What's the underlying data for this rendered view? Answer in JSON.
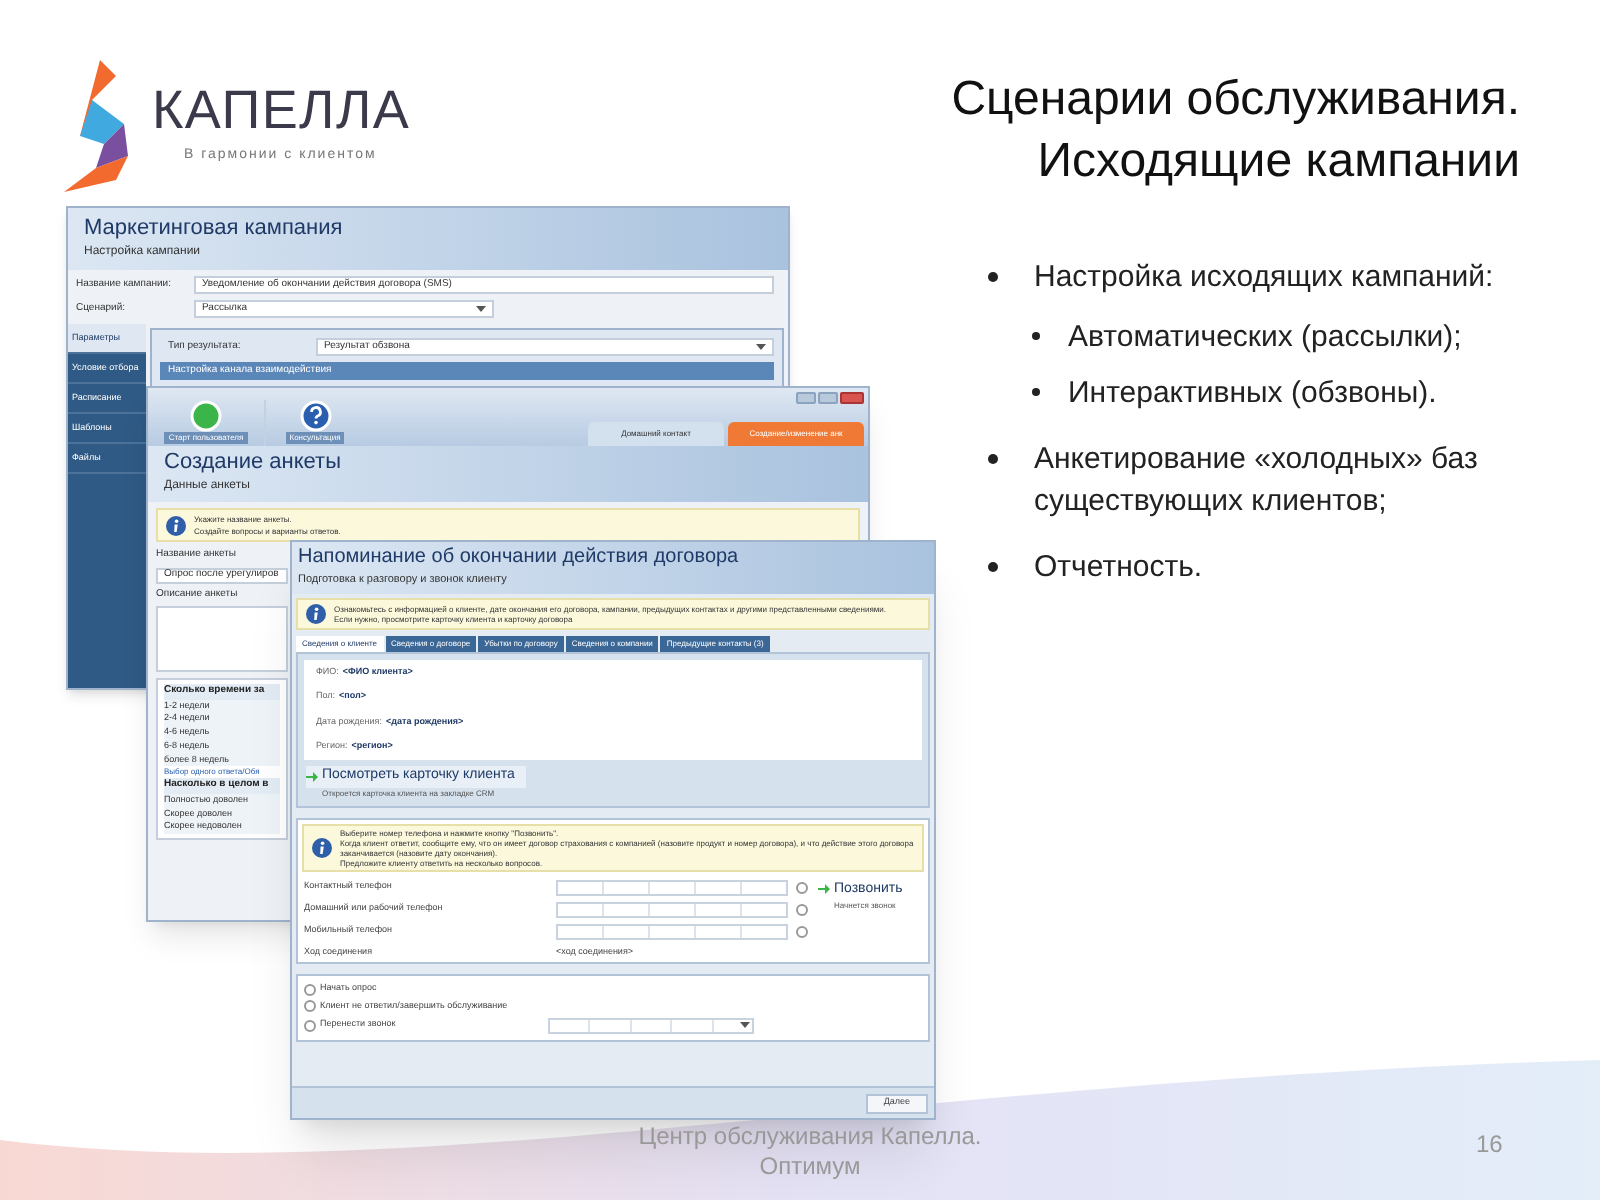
{
  "logo": {
    "name": "КАПЕЛЛА",
    "tagline": "В гармонии с клиентом"
  },
  "title": [
    "Сценарии обслуживания.",
    "Исходящие кампании"
  ],
  "campaign_window": {
    "title": "Маркетинговая кампания",
    "subtitle": "Настройка кампании",
    "fields": [
      {
        "kind": "text",
        "label": "Название кампании:",
        "value": "Уведомление об окончании действия договора (SMS)"
      },
      {
        "kind": "select",
        "label": "Сценарий:",
        "value": "Рассылка"
      }
    ],
    "nav": [
      {
        "label": "Параметры",
        "selected": true
      },
      {
        "label": "Условие отбора",
        "selected": false
      },
      {
        "label": "Расписание",
        "selected": false
      },
      {
        "label": "Шаблоны",
        "selected": false
      },
      {
        "label": "Файлы",
        "selected": false
      }
    ],
    "result_type": {
      "label": "Тип результата:",
      "value": "Результат обзвона"
    },
    "section": "Настройка канала взаимодействия"
  },
  "survey_window": {
    "toolbar": [
      "Старт пользователя",
      "Консультация"
    ],
    "tabs": [
      {
        "label": "Домашний контакт",
        "selected": false
      },
      {
        "label": "Создание/изменение анк",
        "selected": true
      }
    ],
    "title": "Создание анкеты",
    "subtitle": "Данные анкеты",
    "info": [
      "Укажите название анкеты.",
      "Создайте вопросы и варианты ответов."
    ],
    "name_label": "Название анкеты",
    "name_value": "Опрос после урегулиров",
    "description_label": "Описание анкеты",
    "questions": [
      {
        "kind": "question",
        "text": "Сколько времени за"
      },
      {
        "kind": "answer",
        "text": "1-2 недели"
      },
      {
        "kind": "answer",
        "text": "2-4 недели"
      },
      {
        "kind": "answer",
        "text": "4-6 недель"
      },
      {
        "kind": "answer",
        "text": "6-8 недель"
      },
      {
        "kind": "answer",
        "text": "более 8 недель"
      },
      {
        "kind": "link",
        "text": "Выбор одного ответа/Обя"
      },
      {
        "kind": "question",
        "text": "Насколько в целом в"
      },
      {
        "kind": "answer",
        "text": "Полностью доволен"
      },
      {
        "kind": "answer",
        "text": "Скорее доволен"
      },
      {
        "kind": "answer",
        "text": "Скорее недоволен"
      }
    ]
  },
  "call_window": {
    "title": "Напоминание об окончании действия договора",
    "subtitle": "Подготовка к разговору и звонок клиенту",
    "info": [
      "Ознакомьтесь с информацией о клиенте, дате окончания его договора, кампании, предыдущих контактах и другими представленными сведениями.",
      "Если нужно, просмотрите карточку клиента и карточку договора"
    ],
    "tabs": [
      {
        "label": "Сведения о клиенте",
        "selected": true
      },
      {
        "label": "Сведения о договоре",
        "selected": false
      },
      {
        "label": "Убытки по договору",
        "selected": false
      },
      {
        "label": "Сведения о компании",
        "selected": false
      },
      {
        "label": "Предыдущие контакты (3)",
        "selected": false
      }
    ],
    "client": [
      {
        "label": "ФИО:",
        "value": "<ФИО клиента>"
      },
      {
        "label": "Пол:",
        "value": "<пол>"
      },
      {
        "label": "Дата рождения:",
        "value": "<дата рождения>"
      },
      {
        "label": "Регион:",
        "value": "<регион>"
      }
    ],
    "card_link": {
      "label": "Посмотреть карточку клиента",
      "hint": "Откроется карточка клиента на закладке CRM"
    },
    "call_info": [
      "Выберите номер телефона и нажмите кнопку \"Позвонить\".",
      "Когда клиент ответит, сообщите ему, что он имеет договор страхования с компанией (назовите продукт и номер договора), и что действие этого договора заканчивается (назовите дату окончания).",
      "Предложите клиенту ответить на несколько вопросов."
    ],
    "phones": [
      {
        "label": "Контактный телефон",
        "checked": false
      },
      {
        "label": "Домашний или рабочий телефон",
        "checked": false
      },
      {
        "label": "Мобильный телефон",
        "checked": false
      }
    ],
    "call_button": {
      "label": "Позвонить",
      "hint": "Начнется звонок"
    },
    "progress": {
      "label": "Ход соединения",
      "value": "<ход соединения>"
    },
    "options": [
      {
        "label": "Начать опрос",
        "checked": false
      },
      {
        "label": "Клиент не ответил/завершить обслуживание",
        "checked": false
      },
      {
        "label": "Перенести звонок",
        "checked": false
      }
    ],
    "next_button": "Далее"
  },
  "bullets": [
    {
      "text": "Настройка исходящих кампаний:",
      "children": [
        {
          "text": "Автоматических (рассылки);"
        },
        {
          "text": "Интерактивных (обзвоны)."
        }
      ]
    },
    {
      "text": "Анкетирование «холодных» баз существующих клиентов;"
    },
    {
      "text": "Отчетность."
    }
  ],
  "footer": {
    "text": "Центр обслуживания Капелла. Оптимум",
    "page": "16"
  }
}
